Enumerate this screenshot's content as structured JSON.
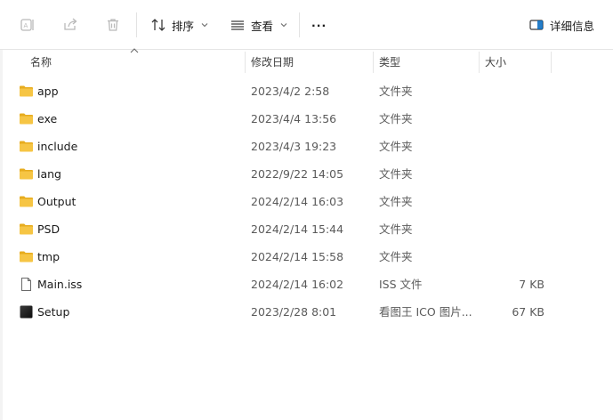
{
  "toolbar": {
    "sort_label": "排序",
    "view_label": "查看",
    "more_label": "···",
    "details_label": "详细信息"
  },
  "columns": {
    "name": "名称",
    "modified": "修改日期",
    "type": "类型",
    "size": "大小"
  },
  "files": [
    {
      "name": "app",
      "date": "2023/4/2 2:58",
      "type": "文件夹",
      "size": "",
      "kind": "folder"
    },
    {
      "name": "exe",
      "date": "2023/4/4 13:56",
      "type": "文件夹",
      "size": "",
      "kind": "folder"
    },
    {
      "name": "include",
      "date": "2023/4/3 19:23",
      "type": "文件夹",
      "size": "",
      "kind": "folder"
    },
    {
      "name": "lang",
      "date": "2022/9/22 14:05",
      "type": "文件夹",
      "size": "",
      "kind": "folder"
    },
    {
      "name": "Output",
      "date": "2024/2/14 16:03",
      "type": "文件夹",
      "size": "",
      "kind": "folder"
    },
    {
      "name": "PSD",
      "date": "2024/2/14 15:44",
      "type": "文件夹",
      "size": "",
      "kind": "folder"
    },
    {
      "name": "tmp",
      "date": "2024/2/14 15:58",
      "type": "文件夹",
      "size": "",
      "kind": "folder"
    },
    {
      "name": "Main.iss",
      "date": "2024/2/14 16:02",
      "type": "ISS 文件",
      "size": "7 KB",
      "kind": "document"
    },
    {
      "name": "Setup",
      "date": "2023/2/28 8:01",
      "type": "看图王 ICO 图片...",
      "size": "67 KB",
      "kind": "image"
    }
  ],
  "colors": {
    "folder": "#f6c544",
    "folder_dark": "#e7ac1e",
    "accent": "#0067c0"
  }
}
